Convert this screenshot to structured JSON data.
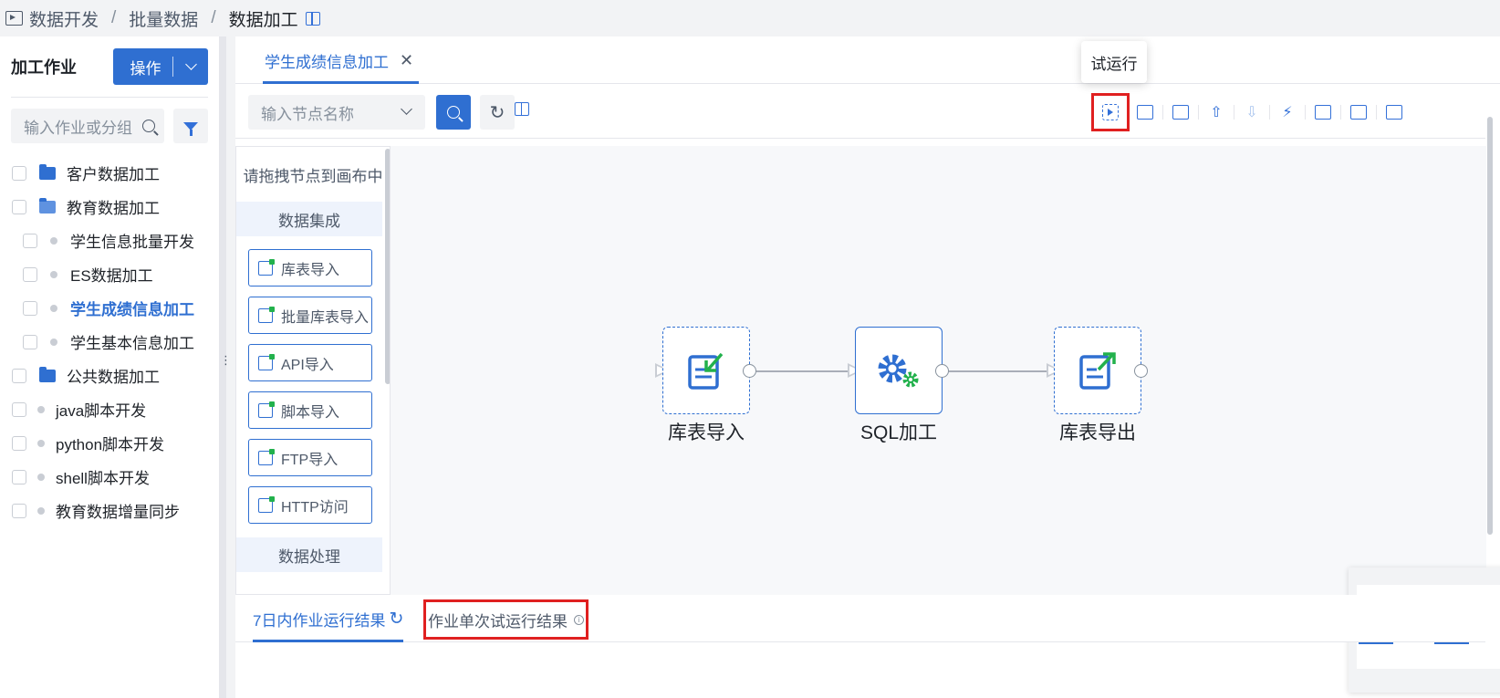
{
  "breadcrumb": [
    "数据开发",
    "批量数据",
    "数据加工"
  ],
  "left": {
    "title": "加工作业",
    "op_button": "操作",
    "search_placeholder": "输入作业或分组",
    "tree": [
      {
        "label": "客户数据加工",
        "type": "folder"
      },
      {
        "label": "教育数据加工",
        "type": "folder-open"
      },
      {
        "label": "学生信息批量开发",
        "type": "job",
        "indent": true
      },
      {
        "label": "ES数据加工",
        "type": "job",
        "indent": true
      },
      {
        "label": "学生成绩信息加工",
        "type": "job",
        "indent": true,
        "active": true
      },
      {
        "label": "学生基本信息加工",
        "type": "job",
        "indent": true
      },
      {
        "label": "公共数据加工",
        "type": "folder"
      },
      {
        "label": "java脚本开发",
        "type": "job"
      },
      {
        "label": "python脚本开发",
        "type": "job"
      },
      {
        "label": "shell脚本开发",
        "type": "job"
      },
      {
        "label": "教育数据增量同步",
        "type": "job"
      }
    ]
  },
  "main": {
    "tab_label": "学生成绩信息加工",
    "node_search_placeholder": "输入节点名称",
    "tooltip": "试运行",
    "palette": {
      "hint": "请拖拽节点到画布中",
      "group1": "数据集成",
      "items": [
        "库表导入",
        "批量库表导入",
        "API导入",
        "脚本导入",
        "FTP导入",
        "HTTP访问"
      ],
      "group2": "数据处理"
    },
    "nodes": [
      {
        "label": "库表导入"
      },
      {
        "label": "SQL加工"
      },
      {
        "label": "库表导出"
      }
    ],
    "bottom_tabs": {
      "tab1": "7日内作业运行结果",
      "tab2": "作业单次试运行结果"
    }
  }
}
